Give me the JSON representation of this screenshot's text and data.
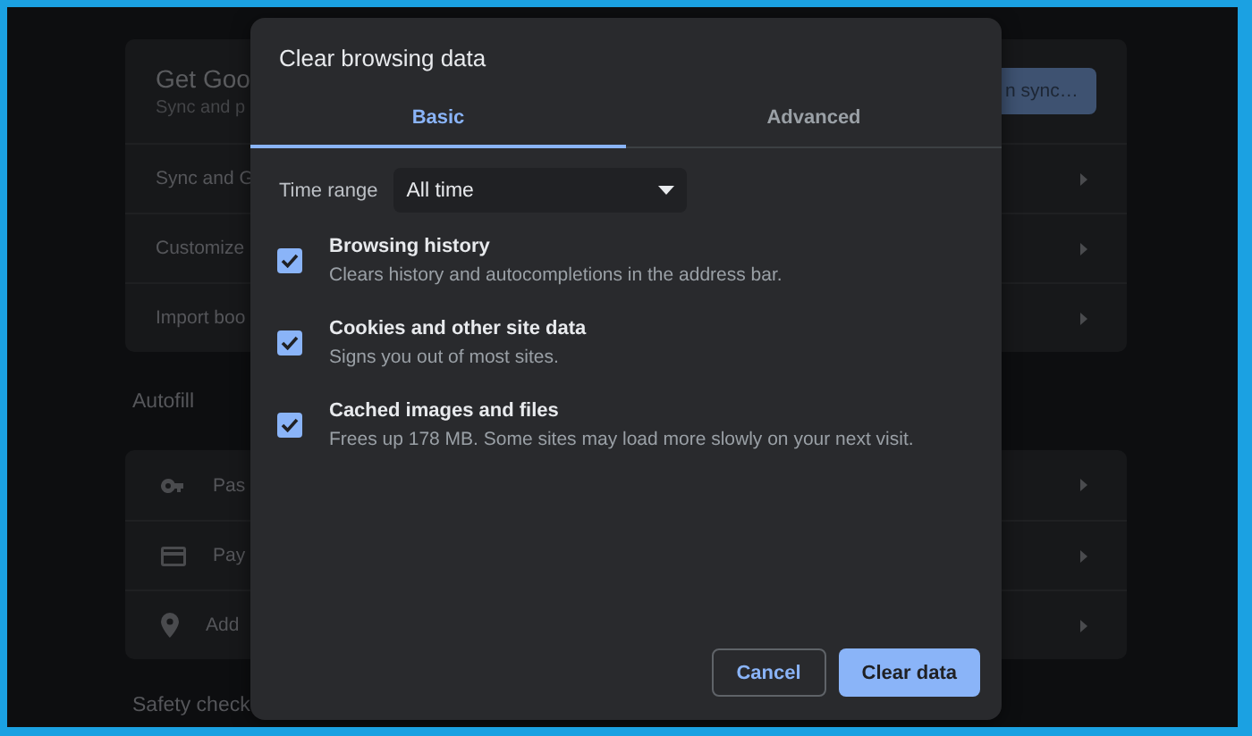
{
  "settings": {
    "sync_card": {
      "title": "Get Goo",
      "subtitle": "Sync and p",
      "button": "n sync…",
      "rows": [
        "Sync and G",
        "Customize",
        "Import boo"
      ]
    },
    "autofill": {
      "heading": "Autofill",
      "rows": [
        {
          "kind": "key",
          "label": "Pas"
        },
        {
          "kind": "card",
          "label": "Pay"
        },
        {
          "kind": "pin",
          "label": "Add"
        }
      ]
    },
    "next_heading": "Safety check"
  },
  "dialog": {
    "title": "Clear browsing data",
    "tabs": [
      {
        "label": "Basic",
        "selected": true
      },
      {
        "label": "Advanced",
        "selected": false
      }
    ],
    "time_range": {
      "label": "Time range",
      "value": "All time"
    },
    "options": [
      {
        "title": "Browsing history",
        "description": "Clears history and autocompletions in the address bar.",
        "checked": true
      },
      {
        "title": "Cookies and other site data",
        "description": "Signs you out of most sites.",
        "checked": true
      },
      {
        "title": "Cached images and files",
        "description": "Frees up 178 MB. Some sites may load more slowly on your next visit.",
        "checked": true
      }
    ],
    "buttons": [
      {
        "label": "Cancel",
        "kind": "secondary"
      },
      {
        "label": "Clear data",
        "kind": "primary"
      }
    ]
  }
}
